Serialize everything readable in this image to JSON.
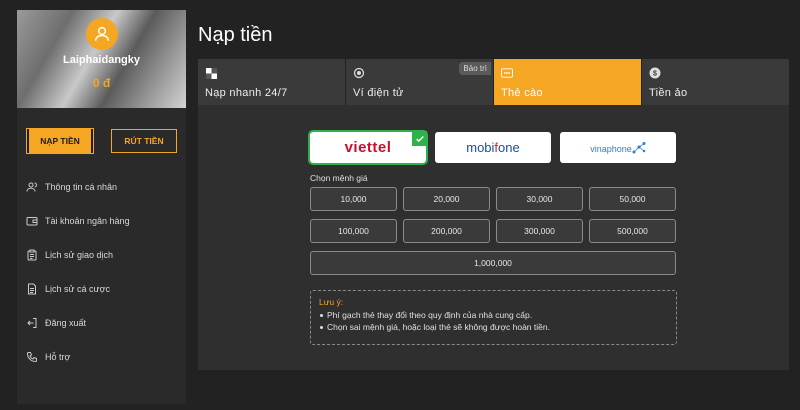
{
  "user": {
    "username": "Laiphaidangky",
    "balance": "0 đ"
  },
  "actions": {
    "deposit": "NẠP TIỀN",
    "withdraw": "RÚT TIỀN"
  },
  "menu": [
    {
      "label": "Thông tin cá nhân",
      "icon": "user-icon"
    },
    {
      "label": "Tài khoản ngân hàng",
      "icon": "wallet-icon"
    },
    {
      "label": "Lịch sử giao dịch",
      "icon": "clipboard-icon"
    },
    {
      "label": "Lịch sử cá cược",
      "icon": "document-icon"
    },
    {
      "label": "Đăng xuất",
      "icon": "logout-icon"
    },
    {
      "label": "Hỗ trợ",
      "icon": "phone-icon"
    }
  ],
  "page": {
    "title": "Nạp tiền"
  },
  "tabs": [
    {
      "label": "Nạp nhanh 24/7",
      "icon": "checker-icon"
    },
    {
      "label": "Ví điện tử",
      "icon": "target-icon",
      "badge": "Bảo trì"
    },
    {
      "label": "Thẻ cào",
      "icon": "card-icon",
      "active": true
    },
    {
      "label": "Tiền ảo",
      "icon": "dollar-coin-icon"
    }
  ],
  "carriers": [
    {
      "name": "viettel",
      "selected": true
    },
    {
      "name": "mobifone",
      "selected": false
    },
    {
      "name": "vinaphone",
      "selected": false
    }
  ],
  "denomination": {
    "label": "Chọn mệnh giá",
    "options": [
      "10,000",
      "20,000",
      "30,000",
      "50,000",
      "100,000",
      "200,000",
      "300,000",
      "500,000",
      "1,000,000"
    ]
  },
  "notice": {
    "title": "Lưu ý:",
    "items": [
      "Phí gạch thẻ thay đổi theo quy định của nhà cung cấp.",
      "Chọn sai mệnh giá, hoặc loại thẻ sẽ không được hoàn tiền."
    ]
  },
  "colors": {
    "accent": "#f5a623",
    "selected": "#2fb24c",
    "background": "#222222",
    "panel": "#2f2f2f"
  }
}
